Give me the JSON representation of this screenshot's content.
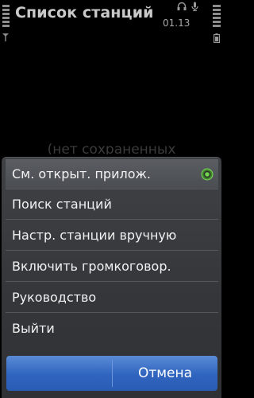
{
  "header": {
    "title": "Список станций",
    "clock": "01.13"
  },
  "background": {
    "empty_text": "(нет сохраненных"
  },
  "options_menu": {
    "items": [
      {
        "label": "См. открыт. прилож.",
        "active_indicator": true
      },
      {
        "label": "Поиск станций"
      },
      {
        "label": "Настр. станции вручную"
      },
      {
        "label": "Включить громкоговор."
      },
      {
        "label": "Руководство"
      },
      {
        "label": "Выйти"
      }
    ]
  },
  "softkeys": {
    "right": "Отмена"
  },
  "colors": {
    "accent": "#2f64bf",
    "indicator_green": "#5ec640",
    "menu_bg": "#3a3c40"
  },
  "icons": [
    "signal-strength-icon",
    "antenna-icon",
    "headset-icon",
    "alarm-icon",
    "battery-icon",
    "active-app-indicator-icon"
  ]
}
